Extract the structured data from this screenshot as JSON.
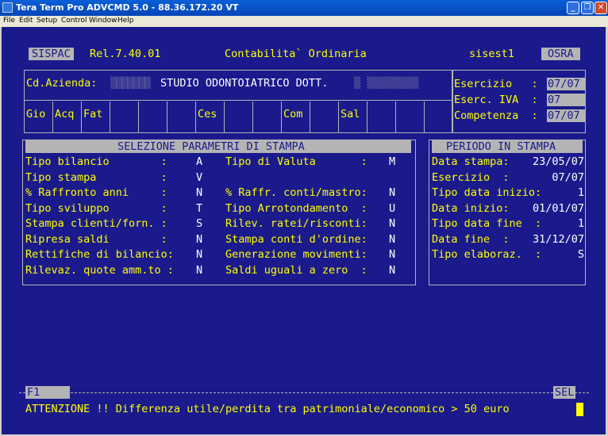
{
  "window": {
    "title": "Tera Term Pro ADVCMD 5.0 - 88.36.172.20 VT",
    "controls": [
      "_",
      "❐",
      "✕"
    ]
  },
  "menu": [
    "File",
    "Edit",
    "Setup",
    "Control",
    "Window",
    "Help"
  ],
  "header": {
    "app_button": "SISPAC",
    "release": "Rel.7.40.01",
    "module": "Contabilita` Ordinaria",
    "user": "sisest1",
    "company_code": "OSRA"
  },
  "company": {
    "label": "Cd.Azienda:",
    "name": "STUDIO ODONTOIATRICO DOTT."
  },
  "function_keys": [
    "Gio",
    "Acq",
    "Fat",
    "",
    "",
    "",
    "Ces",
    "",
    "",
    "Com",
    "",
    "Sal",
    "",
    "",
    ""
  ],
  "period_info": [
    {
      "label": "Esercizio   :",
      "value": "07/07"
    },
    {
      "label": "Eserc. IVA  :",
      "value": "07"
    },
    {
      "label": "Competenza  :",
      "value": "07/07"
    }
  ],
  "params": {
    "title": "SELEZIONE PARAMETRI DI STAMPA",
    "left": [
      {
        "label": "Tipo bilancio        :",
        "value": "A"
      },
      {
        "label": "Tipo stampa          :",
        "value": "V"
      },
      {
        "label": "% Raffronto anni     :",
        "value": "N"
      },
      {
        "label": "Tipo sviluppo        :",
        "value": "T"
      },
      {
        "label": "Stampa clienti/forn. :",
        "value": "S"
      },
      {
        "label": "Ripresa saldi        :",
        "value": "N"
      },
      {
        "label": "Rettifiche di bilancio:",
        "value": "N"
      },
      {
        "label": "Rilevaz. quote amm.to :",
        "value": "N"
      }
    ],
    "right": [
      {
        "label": "Tipo di Valuta       :",
        "value": "M"
      },
      {
        "label": "",
        "value": ""
      },
      {
        "label": "% Raffr. conti/mastro:",
        "value": "N"
      },
      {
        "label": "Tipo Arrotondamento  :",
        "value": "U"
      },
      {
        "label": "Rilev. ratei/risconti:",
        "value": "N"
      },
      {
        "label": "Stampa conti d'ordine:",
        "value": "N"
      },
      {
        "label": "Generazione movimenti:",
        "value": "N"
      },
      {
        "label": "Saldi uguali a zero  :",
        "value": "N"
      }
    ]
  },
  "period": {
    "title": "PERIODO IN STAMPA",
    "rows": [
      {
        "label": "Data stampa:",
        "value": "23/05/07"
      },
      {
        "label": "Esercizio  :",
        "value": "07/07"
      },
      {
        "label": "Tipo data inizio:",
        "value": "1"
      },
      {
        "label": "Data inizio:",
        "value": "01/01/07"
      },
      {
        "label": "Tipo data fine  :",
        "value": "1"
      },
      {
        "label": "Data fine  :",
        "value": "31/12/07"
      },
      {
        "label": "Tipo elaboraz.  :",
        "value": "S"
      }
    ]
  },
  "footer": {
    "f1": "F1",
    "sel": "SEL",
    "message": "ATTENZIONE !! Differenza utile/perdita tra patrimoniale/economico > 50 euro"
  }
}
